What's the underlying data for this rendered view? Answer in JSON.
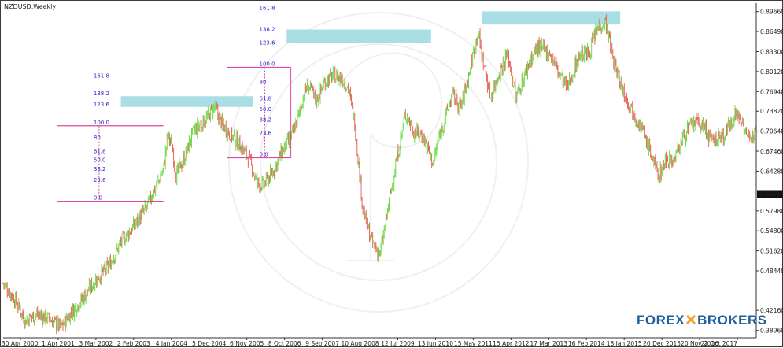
{
  "window": {
    "symbol_title": "NZDUSD,Weekly"
  },
  "brand": {
    "part1": "FOREX",
    "part2": "BROKERS",
    "color": "#1d5f9c"
  },
  "colors": {
    "bull": "#6edc4a",
    "bear": "#e8685e",
    "fib": "#e0479e",
    "fib_text": "#2626c8",
    "zone": "#9bd8e0",
    "hline": "#a9a9a9",
    "axis": "#333333"
  },
  "chart_data": {
    "type": "candlestick",
    "ylim": [
      0.378,
      0.91
    ],
    "y_ticks": [
      "0.89660",
      "0.86490",
      "0.83300",
      "0.80120",
      "0.76940",
      "0.73820",
      "0.70640",
      "0.67460",
      "0.64280",
      "0.57980",
      "0.54800",
      "0.51620",
      "0.48440",
      "0.42160",
      "0.38960"
    ],
    "current_price": "0.60644",
    "x_ticks": [
      "30 Apr 2000",
      "1 Apr 2001",
      "3 Mar 2002",
      "2 Feb 2003",
      "4 Jan 2004",
      "5 Dec 2004",
      "6 Nov 2005",
      "8 Oct 2006",
      "9 Sep 2007",
      "10 Aug 2008",
      "12 Jul 2009",
      "13 Jun 2010",
      "15 May 2011",
      "15 Apr 2012",
      "17 Mar 2013",
      "16 Feb 2014",
      "18 Jan 2015",
      "20 Dec 2015",
      "20 Nov 2016",
      "22 Oct 2017"
    ],
    "price_path": [
      [
        2000.33,
        0.465
      ],
      [
        2000.6,
        0.44
      ],
      [
        2000.85,
        0.405
      ],
      [
        2001.1,
        0.415
      ],
      [
        2001.35,
        0.41
      ],
      [
        2001.7,
        0.395
      ],
      [
        2001.9,
        0.415
      ],
      [
        2002.2,
        0.44
      ],
      [
        2002.5,
        0.47
      ],
      [
        2002.8,
        0.49
      ],
      [
        2003.1,
        0.53
      ],
      [
        2003.4,
        0.555
      ],
      [
        2003.7,
        0.585
      ],
      [
        2003.9,
        0.615
      ],
      [
        2004.1,
        0.645
      ],
      [
        2004.2,
        0.7
      ],
      [
        2004.3,
        0.685
      ],
      [
        2004.4,
        0.635
      ],
      [
        2004.6,
        0.665
      ],
      [
        2004.8,
        0.705
      ],
      [
        2005.1,
        0.725
      ],
      [
        2005.3,
        0.745
      ],
      [
        2005.5,
        0.715
      ],
      [
        2005.7,
        0.7
      ],
      [
        2005.9,
        0.685
      ],
      [
        2006.1,
        0.665
      ],
      [
        2006.3,
        0.625
      ],
      [
        2006.45,
        0.62
      ],
      [
        2006.7,
        0.645
      ],
      [
        2006.9,
        0.675
      ],
      [
        2007.1,
        0.695
      ],
      [
        2007.3,
        0.735
      ],
      [
        2007.4,
        0.765
      ],
      [
        2007.5,
        0.78
      ],
      [
        2007.7,
        0.755
      ],
      [
        2007.9,
        0.785
      ],
      [
        2008.1,
        0.795
      ],
      [
        2008.3,
        0.79
      ],
      [
        2008.45,
        0.775
      ],
      [
        2008.6,
        0.72
      ],
      [
        2008.8,
        0.58
      ],
      [
        2009.0,
        0.53
      ],
      [
        2009.2,
        0.51
      ],
      [
        2009.4,
        0.59
      ],
      [
        2009.6,
        0.665
      ],
      [
        2009.8,
        0.735
      ],
      [
        2010.0,
        0.705
      ],
      [
        2010.2,
        0.7
      ],
      [
        2010.45,
        0.655
      ],
      [
        2010.6,
        0.7
      ],
      [
        2010.9,
        0.765
      ],
      [
        2011.1,
        0.745
      ],
      [
        2011.3,
        0.8
      ],
      [
        2011.5,
        0.865
      ],
      [
        2011.6,
        0.825
      ],
      [
        2011.8,
        0.76
      ],
      [
        2012.0,
        0.8
      ],
      [
        2012.2,
        0.83
      ],
      [
        2012.4,
        0.76
      ],
      [
        2012.7,
        0.815
      ],
      [
        2012.9,
        0.84
      ],
      [
        2013.2,
        0.83
      ],
      [
        2013.4,
        0.8
      ],
      [
        2013.6,
        0.775
      ],
      [
        2013.9,
        0.83
      ],
      [
        2014.1,
        0.83
      ],
      [
        2014.35,
        0.875
      ],
      [
        2014.5,
        0.88
      ],
      [
        2014.7,
        0.815
      ],
      [
        2014.9,
        0.775
      ],
      [
        2015.1,
        0.745
      ],
      [
        2015.4,
        0.705
      ],
      [
        2015.6,
        0.665
      ],
      [
        2015.75,
        0.635
      ],
      [
        2015.95,
        0.665
      ],
      [
        2016.1,
        0.66
      ],
      [
        2016.35,
        0.7
      ],
      [
        2016.6,
        0.72
      ],
      [
        2016.8,
        0.715
      ],
      [
        2017.0,
        0.69
      ],
      [
        2017.3,
        0.7
      ],
      [
        2017.55,
        0.735
      ],
      [
        2017.75,
        0.72
      ],
      [
        2017.9,
        0.685
      ],
      [
        2018.05,
        0.725
      ]
    ],
    "fib_sets": [
      {
        "low": 0.595,
        "high": 0.715,
        "from": 2001.6,
        "to": 2004.1,
        "levels": [
          "0.0",
          "23.6",
          "38.2",
          "50.0",
          "61.8",
          "80",
          "100.0",
          "123.6",
          "138.2",
          "161.8"
        ]
      },
      {
        "low": 0.664,
        "high": 0.808,
        "from": 2005.6,
        "to": 2007.1,
        "levels": [
          "0.0",
          "23.6",
          "38.2",
          "50.0",
          "61.8",
          "80",
          "100.0",
          "123.6",
          "138.2",
          "161.8"
        ]
      }
    ],
    "zones": [
      {
        "from": 2003.1,
        "to": 2006.2,
        "low": 0.745,
        "high": 0.762
      },
      {
        "from": 2007.0,
        "to": 2010.4,
        "low": 0.847,
        "high": 0.868
      },
      {
        "from": 2011.6,
        "to": 2014.85,
        "low": 0.876,
        "high": 0.897
      }
    ]
  }
}
